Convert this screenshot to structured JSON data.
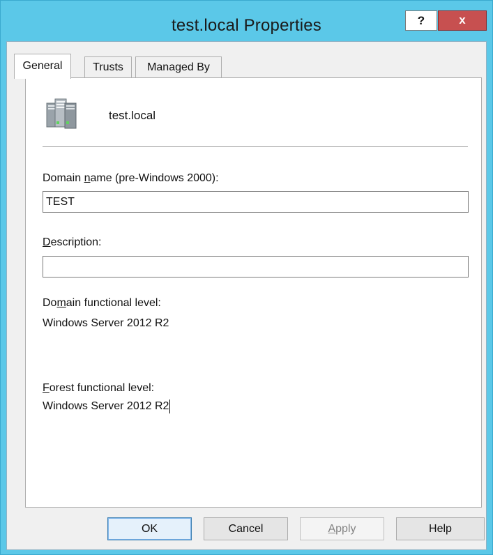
{
  "window": {
    "title": "test.local Properties",
    "help_label": "?",
    "close_label": "x"
  },
  "tabs": [
    {
      "label": "General",
      "active": true
    },
    {
      "label": "Trusts",
      "active": false
    },
    {
      "label": "Managed By",
      "active": false
    }
  ],
  "general": {
    "domain_display_name": "test.local",
    "domain_name_label_pre": "Domain ",
    "domain_name_label_accel": "n",
    "domain_name_label_post": "ame (pre-Windows 2000):",
    "domain_name_value": "TEST",
    "description_label_accel": "D",
    "description_label_post": "escription:",
    "description_value": "",
    "domain_level_label_pre": "Do",
    "domain_level_label_accel": "m",
    "domain_level_label_post": "ain functional level:",
    "domain_level_value": "Windows Server 2012 R2",
    "forest_level_label_accel": "F",
    "forest_level_label_post": "orest functional level:",
    "forest_level_value": "Windows Server 2012 R2"
  },
  "buttons": {
    "ok": "OK",
    "cancel": "Cancel",
    "apply_accel": "A",
    "apply_post": "pply",
    "help": "Help"
  },
  "colors": {
    "titlebar": "#5bc8e8",
    "close_button": "#c75050"
  }
}
